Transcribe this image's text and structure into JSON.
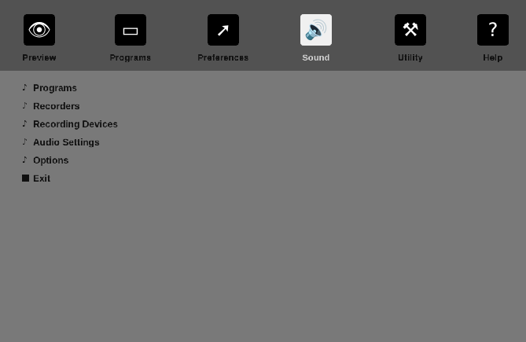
{
  "toolbar": {
    "items": [
      {
        "label": "Preview",
        "icon": "eye-icon",
        "glyph": "👁",
        "enabled": true
      },
      {
        "label": "Programs",
        "icon": "monitor-icon",
        "glyph": "▭",
        "enabled": true
      },
      {
        "label": "Preferences",
        "icon": "pointer-icon",
        "glyph": "➚",
        "enabled": true
      },
      {
        "label": "Sound",
        "icon": "speaker-icon",
        "glyph": "🔊",
        "enabled": false
      },
      {
        "label": "Utility",
        "icon": "tools-icon",
        "glyph": "⚒",
        "enabled": true
      },
      {
        "label": "Help",
        "icon": "help-icon",
        "glyph": "?",
        "enabled": true
      }
    ]
  },
  "menu": {
    "items": [
      {
        "label": "Programs",
        "bullet": "music-note-icon",
        "glyph": "♪"
      },
      {
        "label": "Recorders",
        "bullet": "music-note-icon",
        "glyph": "♪"
      },
      {
        "label": "Recording Devices",
        "bullet": "music-note-icon",
        "glyph": "♪"
      },
      {
        "label": "Audio Settings",
        "bullet": "music-note-icon",
        "glyph": "♪"
      },
      {
        "label": "Options",
        "bullet": "music-note-icon",
        "glyph": "♪"
      },
      {
        "label": "Exit",
        "bullet": "square-bullet-icon",
        "glyph": ""
      }
    ]
  }
}
